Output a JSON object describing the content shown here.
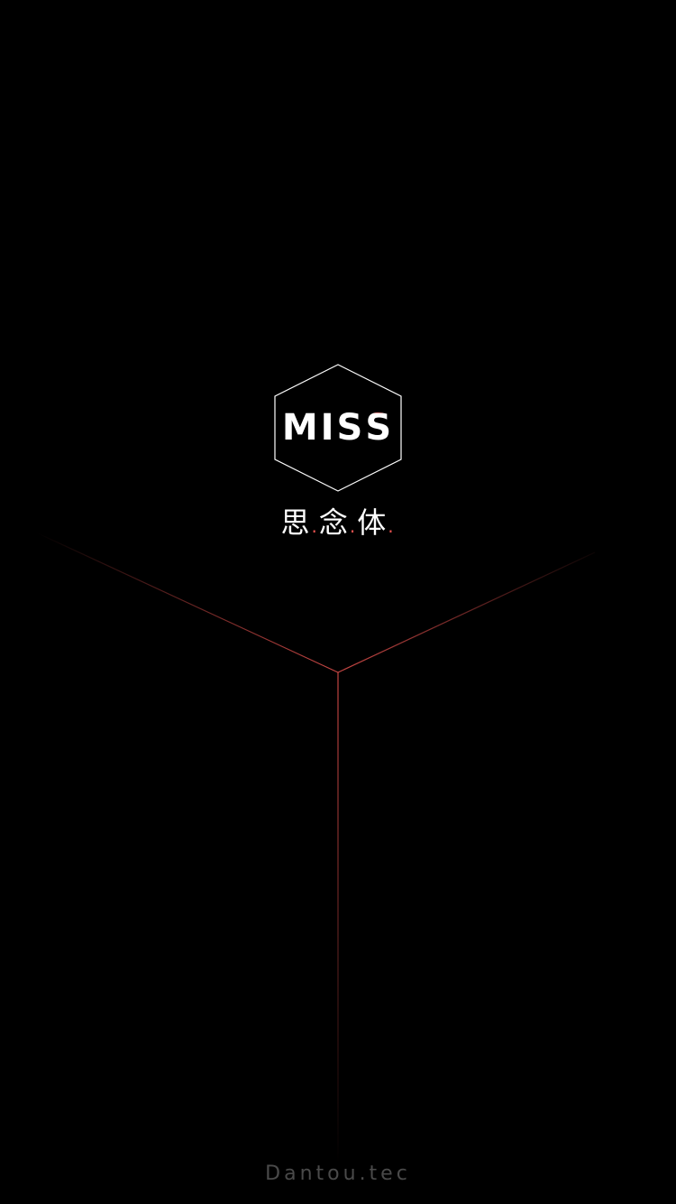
{
  "logo": {
    "word_prefix": "MIS",
    "word_last": "S"
  },
  "brand": {
    "char1": "思",
    "char2": "念",
    "char3": "体",
    "separator": "."
  },
  "footer": {
    "text": "Dantou.tec"
  },
  "colors": {
    "background": "#000000",
    "accent": "#e8524f",
    "text": "#ffffff",
    "footer_text": "#4a4a4a"
  }
}
